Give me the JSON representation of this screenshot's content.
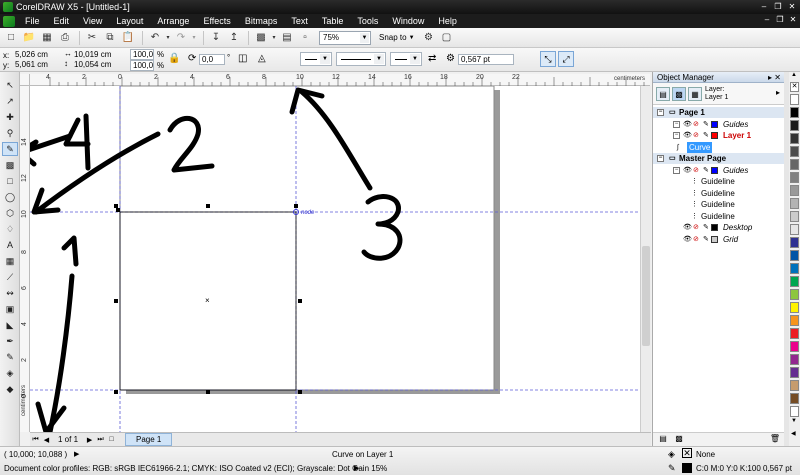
{
  "window": {
    "title": "CorelDRAW X5 - [Untitled-1]"
  },
  "menu": [
    "File",
    "Edit",
    "View",
    "Layout",
    "Arrange",
    "Effects",
    "Bitmaps",
    "Text",
    "Table",
    "Tools",
    "Window",
    "Help"
  ],
  "toolbar": {
    "zoom": "75%",
    "snap_to": "Snap to"
  },
  "property_bar": {
    "x": "5,026 cm",
    "y": "5,061 cm",
    "width": "10,019 cm",
    "height": "10,054 cm",
    "scale_x": "100,0",
    "scale_y": "100,0",
    "percent": "%",
    "rotation": "0,0",
    "outline_width": "0,567 pt"
  },
  "rulers": {
    "h_labels": [
      "4",
      "2",
      "0",
      "2",
      "4",
      "6",
      "8",
      "10",
      "12",
      "14",
      "16",
      "18",
      "20",
      "22"
    ],
    "v_labels": [
      "14",
      "12",
      "10",
      "8",
      "6",
      "4",
      "2",
      "0"
    ],
    "units": "centimeters"
  },
  "canvas": {
    "node_label": "node",
    "annotations": [
      "4",
      "2",
      "1",
      "3"
    ]
  },
  "page_nav": {
    "page_of": "1 of 1",
    "page_tab": "Page 1"
  },
  "status": {
    "coords": "( 10,000; 10,088 )",
    "selection": "Curve on Layer 1",
    "profiles": "Document color profiles: RGB: sRGB IEC61966-2.1; CMYK: ISO Coated v2 (ECI); Grayscale: Dot Gain 15%",
    "fill": "None",
    "outline": "C:0 M:0 Y:0 K:100  0,567 pt"
  },
  "docker": {
    "title": "Object Manager",
    "layer_label": "Layer:",
    "layer_name": "Layer 1",
    "tree": [
      {
        "label": "Page 1",
        "level": 0,
        "header": true
      },
      {
        "label": "Guides",
        "level": 1,
        "italic": true,
        "color": "#0000ff"
      },
      {
        "label": "Layer 1",
        "level": 1,
        "bold": true,
        "color": "#ff0000",
        "text_color": "#cc0000"
      },
      {
        "label": "Curve",
        "level": 2,
        "selected": true
      },
      {
        "label": "Master Page",
        "level": 0,
        "header": true
      },
      {
        "label": "Guides",
        "level": 1,
        "italic": true,
        "color": "#0000ff"
      },
      {
        "label": "Guideline",
        "level": 2
      },
      {
        "label": "Guideline",
        "level": 2
      },
      {
        "label": "Guideline",
        "level": 2
      },
      {
        "label": "Guideline",
        "level": 2
      },
      {
        "label": "Desktop",
        "level": 1,
        "italic": true,
        "color": "#000000"
      },
      {
        "label": "Grid",
        "level": 1,
        "italic": true,
        "color": "#cccccc"
      }
    ]
  },
  "palette": [
    "#ffffff",
    "#000000",
    "#1a1a1a",
    "#333333",
    "#4d4d4d",
    "#666666",
    "#808080",
    "#999999",
    "#b3b3b3",
    "#cccccc",
    "#e6e6e6",
    "#2e3192",
    "#0054a6",
    "#0072bc",
    "#00a651",
    "#8dc63f",
    "#fff200",
    "#f7941d",
    "#ed1c24",
    "#ec008c",
    "#92278f",
    "#662d91",
    "#c69c6d",
    "#754c24",
    "#ffffff"
  ]
}
